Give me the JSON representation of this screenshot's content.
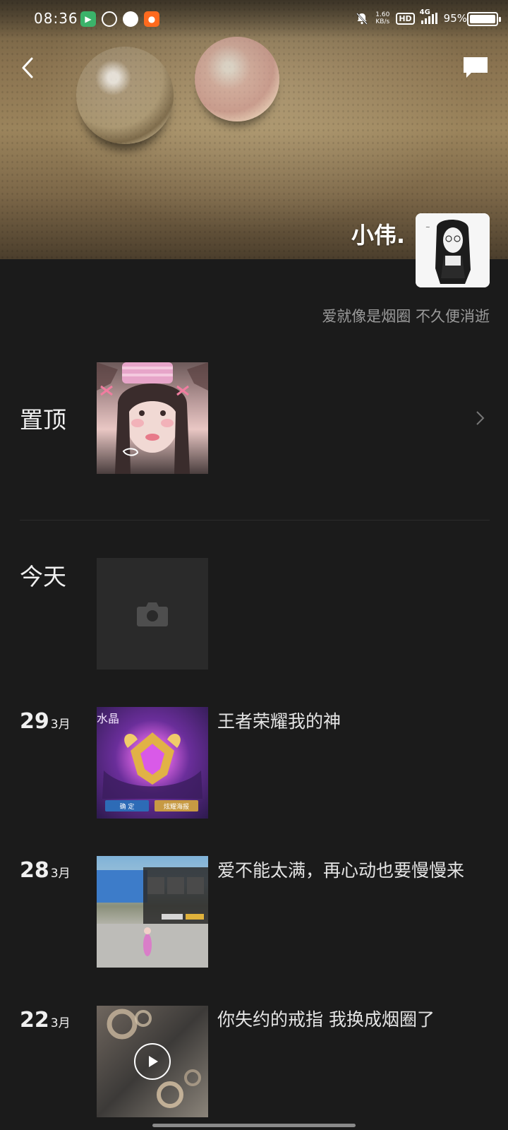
{
  "status_bar": {
    "time": "08:36",
    "net_speed_value": "1.60",
    "net_speed_unit": "KB/s",
    "hd": "HD",
    "network": "4G",
    "battery": "95%"
  },
  "profile": {
    "nickname": "小伟.",
    "signature": "爱就像是烟圈 不久便消逝"
  },
  "feed": {
    "pinned_label": "置顶",
    "today_label": "今天",
    "posts": [
      {
        "day": "29",
        "month": "3月",
        "text": "王者荣耀我的神"
      },
      {
        "day": "28",
        "month": "3月",
        "text": "爱不能太满，再心动也要慢慢来"
      },
      {
        "day": "22",
        "month": "3月",
        "text": "你失约的戒指 我换成烟圈了"
      }
    ]
  },
  "thumbnail_texts": {
    "crystal": "水晶",
    "confirm": "确 定",
    "poster": "炫耀海报"
  }
}
